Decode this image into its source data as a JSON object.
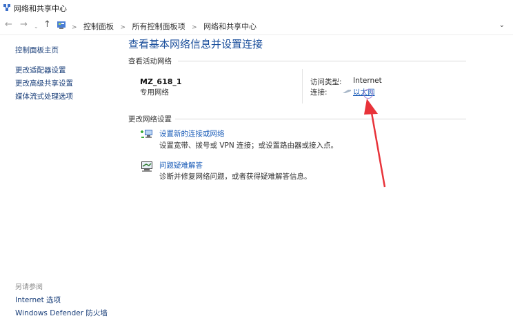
{
  "window": {
    "title": "网络和共享中心"
  },
  "address": {
    "crumbs": [
      "控制面板",
      "所有控制面板项",
      "网络和共享中心"
    ],
    "separator": ">",
    "nav": {
      "back": "←",
      "forward": "→",
      "recent": "⌄",
      "up": "↑",
      "expand": "⌄"
    }
  },
  "sidebar": {
    "home": "控制面板主页",
    "links": [
      "更改适配器设置",
      "更改高级共享设置",
      "媒体流式处理选项"
    ]
  },
  "see_also": {
    "heading": "另请参阅",
    "links": [
      "Internet 选项",
      "Windows Defender 防火墙"
    ]
  },
  "main": {
    "title": "查看基本网络信息并设置连接",
    "active_heading": "查看活动网络",
    "network": {
      "name": "MZ_618_1",
      "type": "专用网络"
    },
    "access_type_label": "访问类型:",
    "access_type_value": "Internet",
    "connection_label": "连接:",
    "connection_link": "以太网",
    "change_heading": "更改网络设置",
    "tasks": [
      {
        "link": "设置新的连接或网络",
        "desc": "设置宽带、拨号或 VPN 连接；或设置路由器或接入点。"
      },
      {
        "link": "问题疑难解答",
        "desc": "诊断并修复网络问题，或者获得疑难解答信息。"
      }
    ]
  },
  "colors": {
    "link": "#1a5cb8",
    "title": "#1b4f9c",
    "sidebar_link": "#1a3f7a",
    "annotation": "#e8333a"
  }
}
